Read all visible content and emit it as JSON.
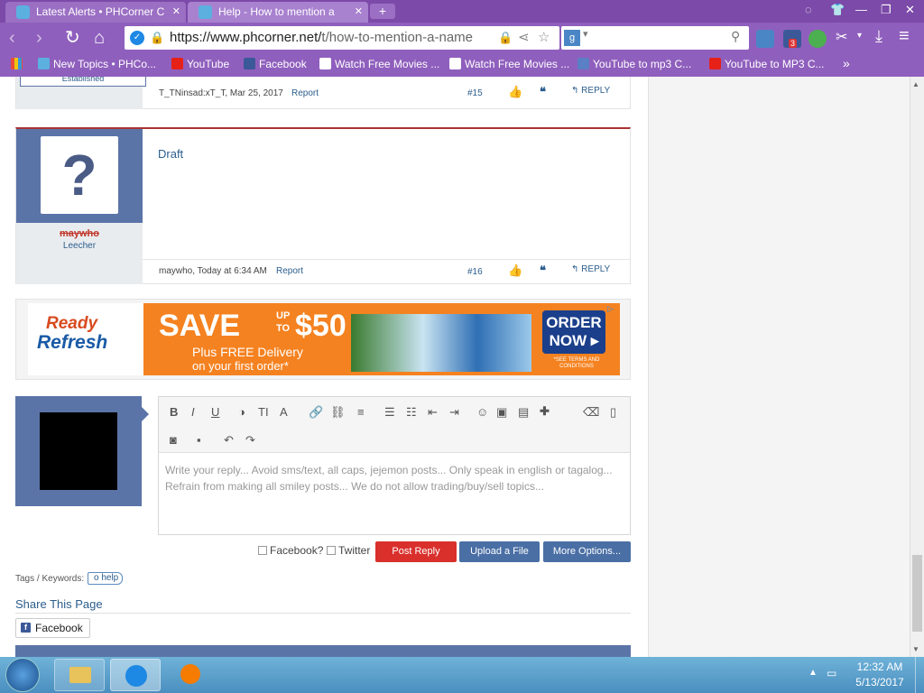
{
  "tabs": [
    {
      "title": "Latest Alerts • PHCorner C"
    },
    {
      "title": "Help - How to mention a"
    }
  ],
  "address": {
    "host": "https://www.phcorner.net/",
    "path": "t/how-to-mention-a-name"
  },
  "bookmarks": [
    {
      "label": "New Topics • PHCo..."
    },
    {
      "label": "YouTube"
    },
    {
      "label": "Facebook"
    },
    {
      "label": "Watch Free Movies ..."
    },
    {
      "label": "Watch Free Movies ..."
    },
    {
      "label": "YouTube to mp3 C..."
    },
    {
      "label": "YouTube to MP3 C..."
    }
  ],
  "ext_badge": "3",
  "post15": {
    "role": "Established",
    "meta": "T_TNinsad:xT_T, Mar 25, 2017",
    "report": "Report",
    "num": "#15",
    "reply": "REPLY"
  },
  "post16": {
    "username": "maywho",
    "role": "Leecher",
    "body": "Draft",
    "meta": "maywho, Today at 6:34 AM",
    "report": "Report",
    "num": "#16",
    "reply": "REPLY"
  },
  "ad": {
    "brand1": "Ready",
    "brand2": "Refresh",
    "save": "SAVE",
    "up": "UP",
    "to": "TO",
    "amount": "$50",
    "line1": "Plus FREE Delivery",
    "line2": "on your first order*",
    "order": "ORDER",
    "now": "NOW ▸",
    "terms": "*SEE TERMS AND CONDITIONS"
  },
  "editor": {
    "placeholder": "Write your reply... Avoid sms/text, all caps, jejemon posts... Only speak in english or tagalog... Refrain from making all smiley posts... We do not allow trading/buy/sell topics..."
  },
  "actions": {
    "facebook": "Facebook?",
    "twitter": "Twitter",
    "post": "Post Reply",
    "upload": "Upload a File",
    "more": "More Options..."
  },
  "tags": {
    "label": "Tags / Keywords:",
    "tag": "o help"
  },
  "share": {
    "title": "Share This Page",
    "facebook": "Facebook"
  },
  "clock": {
    "time": "12:32 AM",
    "date": "5/13/2017"
  }
}
